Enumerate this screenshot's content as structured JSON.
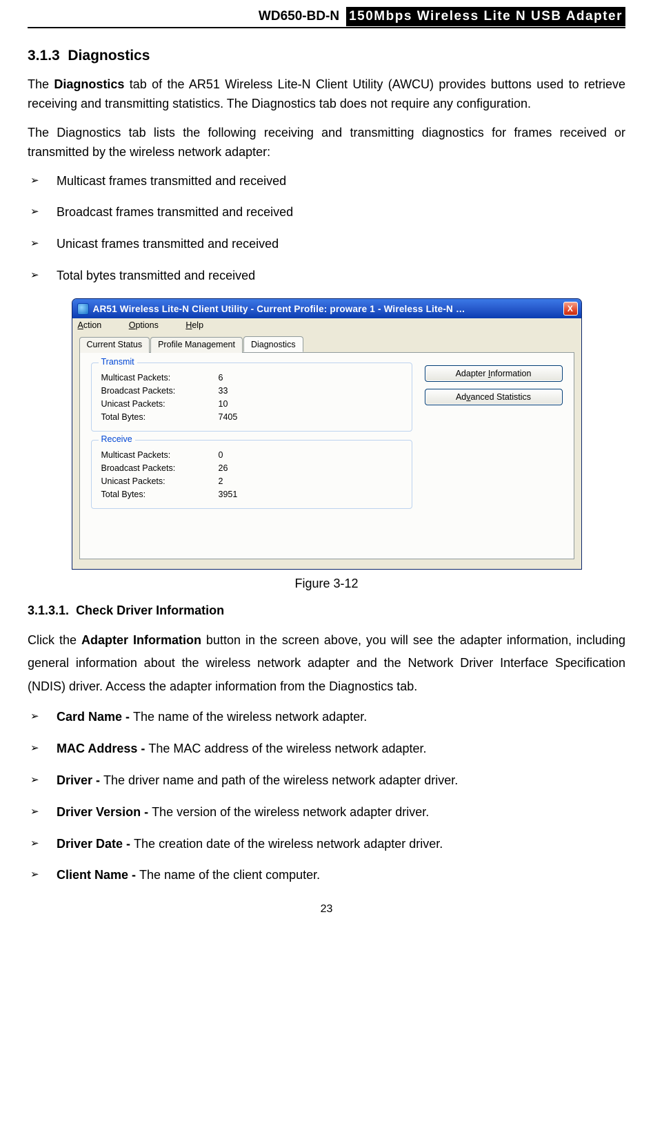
{
  "header": {
    "model": "WD650-BD-N",
    "title": "150Mbps Wireless Lite N USB Adapter"
  },
  "section1": {
    "number": "3.1.3",
    "title": "Diagnostics"
  },
  "para1_a": "The ",
  "para1_bold": "Diagnostics",
  "para1_b": " tab of the AR51 Wireless Lite-N Client Utility (AWCU) provides buttons used to retrieve receiving and transmitting statistics. The Diagnostics tab does not require any configuration.",
  "para2": "The Diagnostics tab lists the following receiving and transmitting diagnostics for frames received or transmitted by the wireless network adapter:",
  "bullets1": [
    "Multicast frames transmitted and received",
    "Broadcast frames transmitted and received",
    "Unicast frames transmitted and received",
    "Total bytes transmitted and received"
  ],
  "window": {
    "title": "AR51 Wireless Lite-N Client Utility - Current Profile: proware 1 - Wireless Lite-N …",
    "close": "X",
    "menu": {
      "action": "Action",
      "options": "Options",
      "help": "Help"
    },
    "tabs": {
      "status": "Current Status",
      "profile": "Profile Management",
      "diag": "Diagnostics"
    },
    "buttons": {
      "adapter_info": "Adapter Information",
      "adv_stats": "Advanced Statistics"
    },
    "groups": {
      "transmit": {
        "title": "Transmit",
        "rows": [
          {
            "label": "Multicast Packets:",
            "value": "6"
          },
          {
            "label": "Broadcast Packets:",
            "value": "33"
          },
          {
            "label": "Unicast Packets:",
            "value": "10"
          },
          {
            "label": "Total Bytes:",
            "value": "7405"
          }
        ]
      },
      "receive": {
        "title": "Receive",
        "rows": [
          {
            "label": "Multicast Packets:",
            "value": "0"
          },
          {
            "label": "Broadcast Packets:",
            "value": "26"
          },
          {
            "label": "Unicast Packets:",
            "value": "2"
          },
          {
            "label": "Total Bytes:",
            "value": "3951"
          }
        ]
      }
    }
  },
  "figure_caption": "Figure 3-12",
  "section2": {
    "number": "3.1.3.1.",
    "title": "Check Driver Information"
  },
  "para3_a": "Click the ",
  "para3_bold": "Adapter Information",
  "para3_b": " button in the screen above, you will see the adapter information, including general information about the wireless network adapter and the Network Driver Interface Specification (NDIS) driver. Access the adapter information from the Diagnostics tab.",
  "bullets2": [
    {
      "term": "Card Name - ",
      "desc": "The name of the wireless network adapter."
    },
    {
      "term": "MAC Address - ",
      "desc": "The MAC address of the wireless network adapter."
    },
    {
      "term": "Driver - ",
      "desc": "The driver name and path of the wireless network adapter driver."
    },
    {
      "term": "Driver Version - ",
      "desc": "The version of the wireless network adapter driver."
    },
    {
      "term": "Driver Date - ",
      "desc": "The creation date of the wireless network adapter driver."
    },
    {
      "term": "Client Name - ",
      "desc": "The name of the client computer."
    }
  ],
  "page_number": "23"
}
